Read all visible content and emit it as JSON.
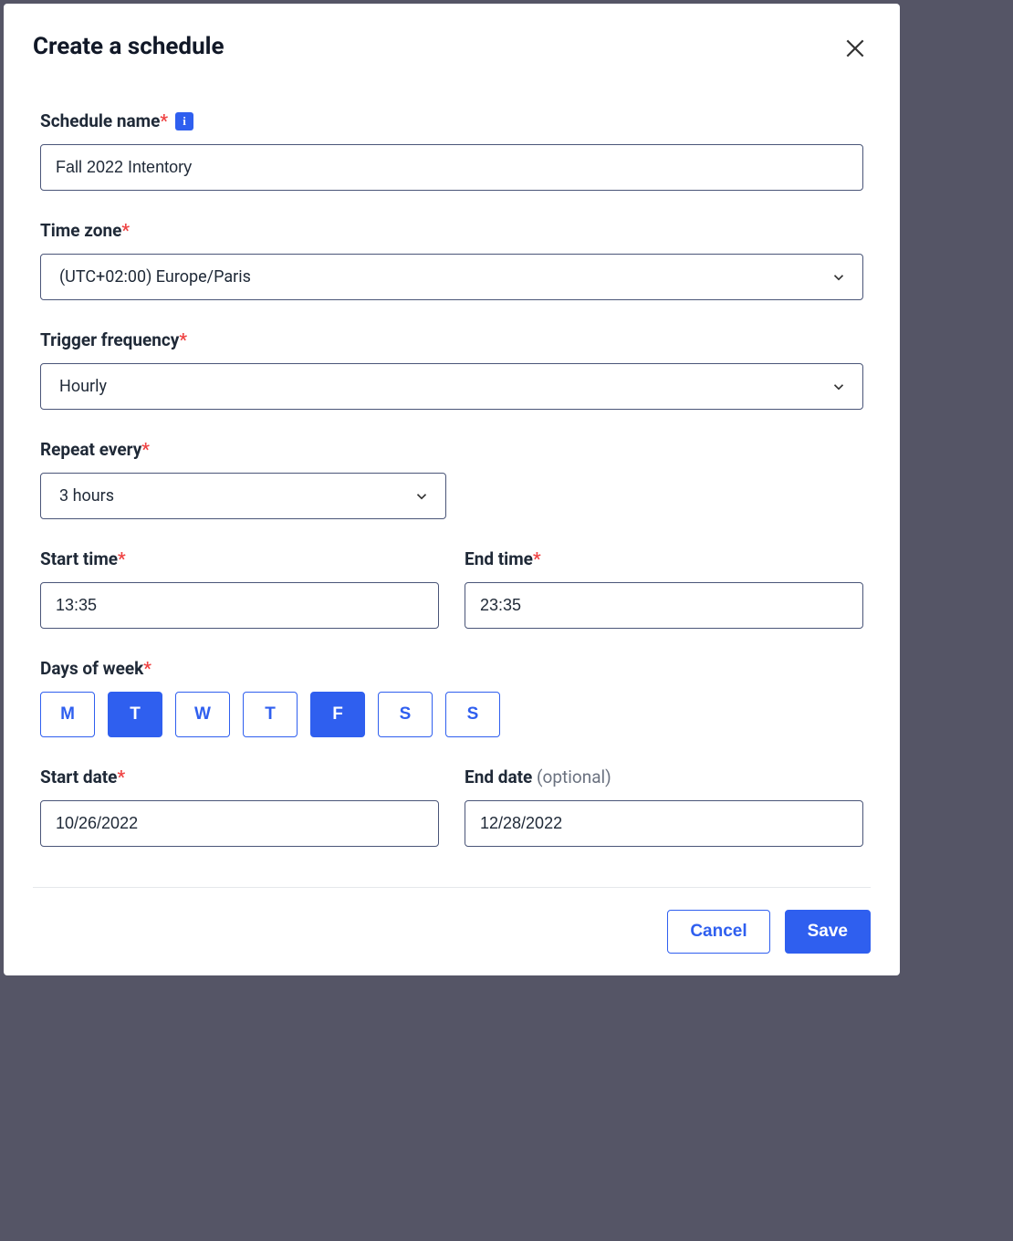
{
  "modal": {
    "title": "Create a schedule",
    "footer": {
      "cancel": "Cancel",
      "save": "Save"
    }
  },
  "fields": {
    "scheduleName": {
      "label": "Schedule name",
      "value": "Fall 2022 Intentory"
    },
    "timeZone": {
      "label": "Time zone",
      "value": "(UTC+02:00) Europe/Paris"
    },
    "triggerFrequency": {
      "label": "Trigger frequency",
      "value": "Hourly"
    },
    "repeatEvery": {
      "label": "Repeat every",
      "value": "3 hours"
    },
    "startTime": {
      "label": "Start time",
      "value": "13:35"
    },
    "endTime": {
      "label": "End time",
      "value": "23:35"
    },
    "daysOfWeek": {
      "label": "Days of week",
      "days": [
        {
          "abbr": "M",
          "selected": false
        },
        {
          "abbr": "T",
          "selected": true
        },
        {
          "abbr": "W",
          "selected": false
        },
        {
          "abbr": "T",
          "selected": false
        },
        {
          "abbr": "F",
          "selected": true
        },
        {
          "abbr": "S",
          "selected": false
        },
        {
          "abbr": "S",
          "selected": false
        }
      ]
    },
    "startDate": {
      "label": "Start date",
      "value": "10/26/2022"
    },
    "endDate": {
      "label": "End date",
      "optional": "(optional)",
      "value": "12/28/2022"
    }
  }
}
